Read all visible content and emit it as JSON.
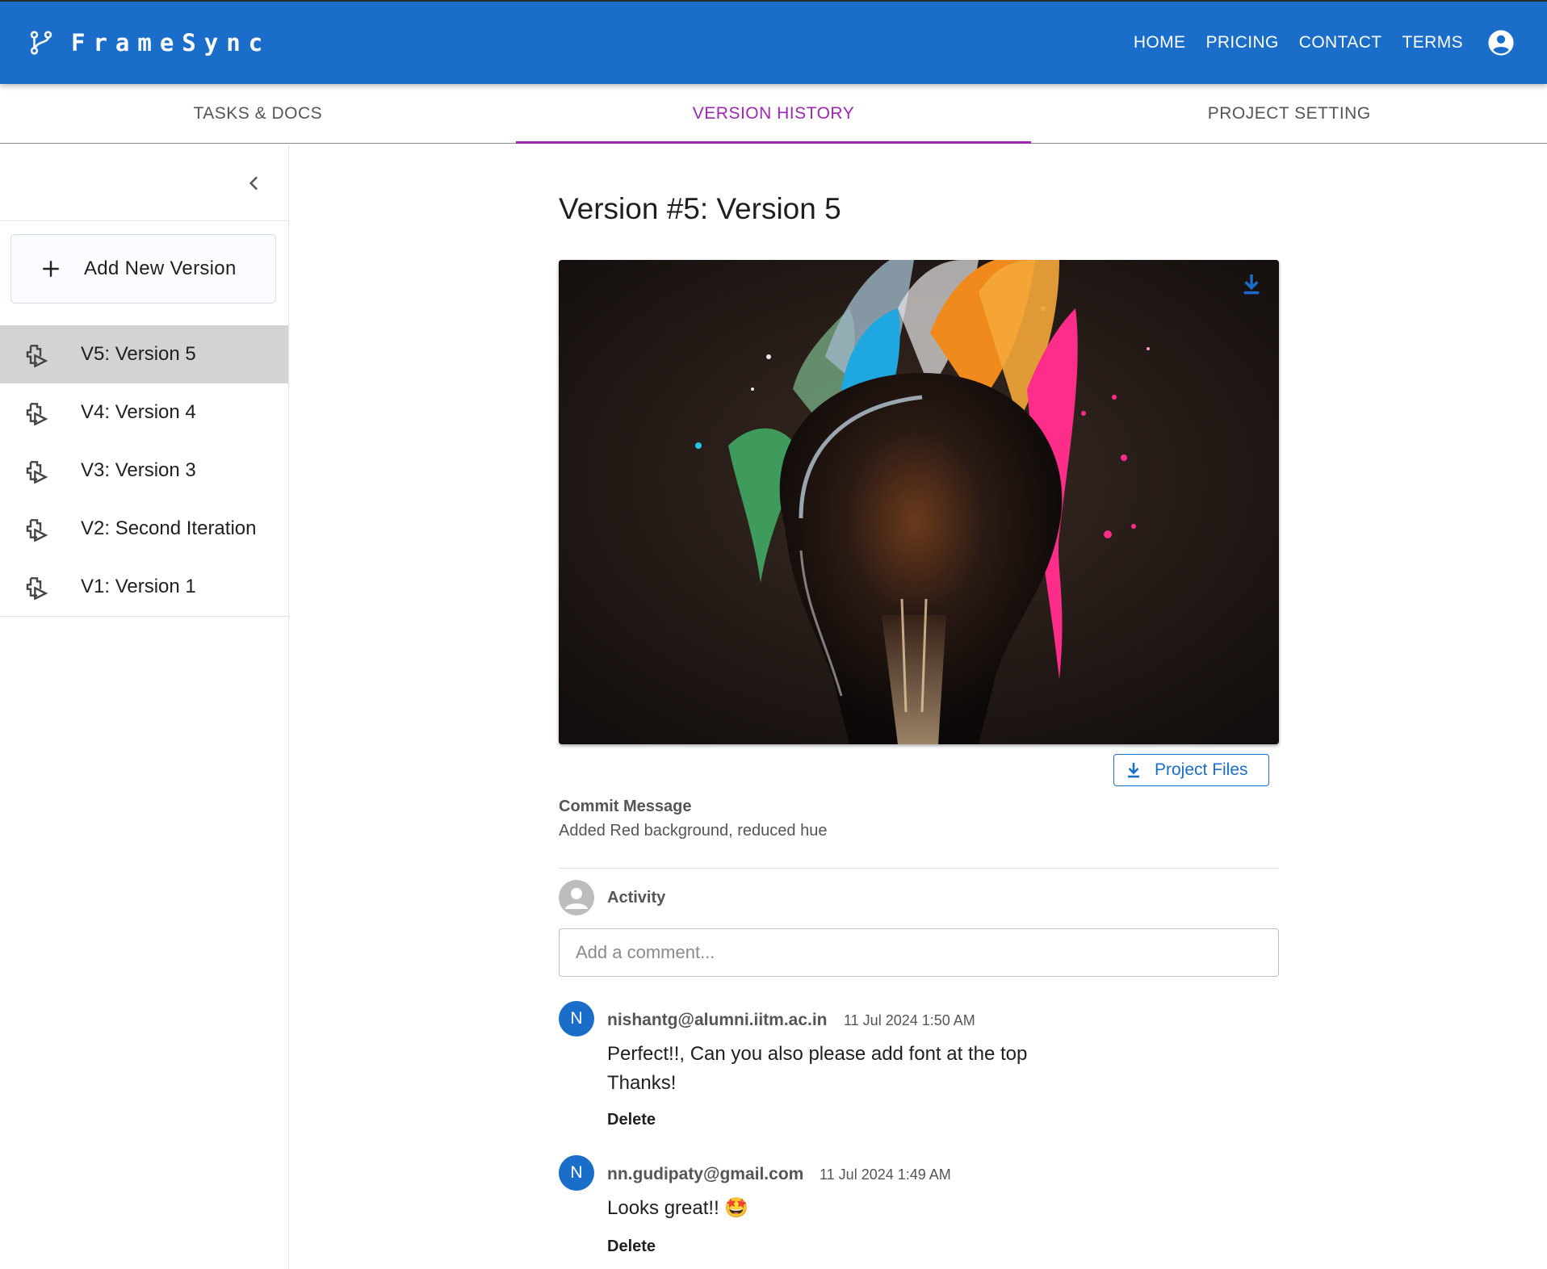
{
  "app": {
    "brand": "FrameSync",
    "brand_color": "#1a6dc8",
    "nav": [
      "HOME",
      "PRICING",
      "CONTACT",
      "TERMS"
    ]
  },
  "tabs": [
    {
      "label": "TASKS & DOCS",
      "active": false
    },
    {
      "label": "VERSION HISTORY",
      "active": true
    },
    {
      "label": "PROJECT SETTING",
      "active": false
    }
  ],
  "sidebar": {
    "add_label": "Add New Version",
    "versions": [
      {
        "label": "V5: Version 5",
        "selected": true
      },
      {
        "label": "V4: Version 4",
        "selected": false
      },
      {
        "label": "V3: Version 3",
        "selected": false
      },
      {
        "label": "V2: Second Iteration",
        "selected": false
      },
      {
        "label": "V1: Version 1",
        "selected": false
      }
    ]
  },
  "main": {
    "title": "Version #5: Version 5",
    "files_button": "Project Files",
    "commit_label": "Commit Message",
    "commit_text": "Added Red background, reduced hue",
    "activity_label": "Activity",
    "comment_placeholder": "Add a comment...",
    "comments": [
      {
        "initial": "N",
        "author": "nishantg@alumni.iitm.ac.in",
        "time": "11 Jul 2024 1:50 AM",
        "lines": [
          "Perfect!!, Can you also please add font at the top",
          "Thanks!"
        ],
        "delete": "Delete"
      },
      {
        "initial": "N",
        "author": "nn.gudipaty@gmail.com",
        "time": "11 Jul 2024 1:49 AM",
        "lines": [
          "Looks great!! 🤩"
        ],
        "delete": "Delete"
      }
    ]
  }
}
